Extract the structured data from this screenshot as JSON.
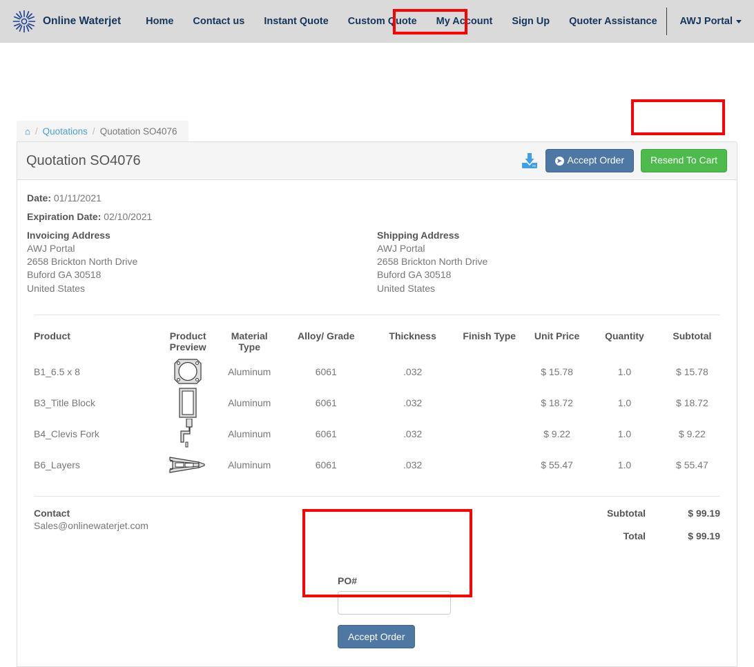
{
  "navbar": {
    "logo_icon": "sunburst-logo-icon",
    "brand": "Online Waterjet",
    "links": [
      {
        "label": "Home",
        "highlighted": false
      },
      {
        "label": "Contact us",
        "highlighted": false
      },
      {
        "label": "Instant Quote",
        "highlighted": false
      },
      {
        "label": "Custom Quote",
        "highlighted": false
      },
      {
        "label": "My Account",
        "highlighted": true
      },
      {
        "label": "Sign Up",
        "highlighted": false
      },
      {
        "label": "Quoter Assistance",
        "highlighted": false
      }
    ],
    "portal": "AWJ Portal",
    "portal_caret_icon": "chevron-down-icon"
  },
  "breadcrumb": {
    "home_icon": "home-icon",
    "separator": "/",
    "link": "Quotations",
    "current": "Quotation SO4076"
  },
  "panel": {
    "title": "Quotation SO4076",
    "download_icon": "download-icon",
    "accept_order_label": "Accept Order",
    "accept_order_icon": "arrow-right-circle-icon",
    "resend_label": "Resend To Cart",
    "accent_blue": "#4e77a3",
    "accent_green": "#4cbb4c",
    "highlight_red": "#fe0000"
  },
  "meta": {
    "date_label": "Date:",
    "date_value": "01/11/2021",
    "expiration_label": "Expiration Date:",
    "expiration_value": "02/10/2021"
  },
  "invoicing_address": {
    "title": "Invoicing Address",
    "lines": [
      "AWJ Portal",
      "2658 Brickton North Drive",
      "Buford GA 30518",
      "United States"
    ]
  },
  "shipping_address": {
    "title": "Shipping Address",
    "lines": [
      "AWJ Portal",
      "2658 Brickton North Drive",
      "Buford GA 30518",
      "United States"
    ]
  },
  "table": {
    "headers": {
      "product": "Product",
      "preview": "Product Preview",
      "material": "Material Type",
      "alloy": "Alloy/ Grade",
      "thickness": "Thickness",
      "finish": "Finish Type",
      "unit_price": "Unit Price",
      "quantity": "Quantity",
      "subtotal": "Subtotal"
    },
    "rows": [
      {
        "product": "B1_6.5 x 8",
        "preview_icon": "part-preview-flange-icon",
        "material": "Aluminum",
        "alloy": "6061",
        "thickness": ".032",
        "finish": "",
        "unit_price": "$ 15.78",
        "quantity": "1.0",
        "subtotal": "$ 15.78"
      },
      {
        "product": "B3_Title Block",
        "preview_icon": "part-preview-block-icon",
        "material": "Aluminum",
        "alloy": "6061",
        "thickness": ".032",
        "finish": "",
        "unit_price": "$ 18.72",
        "quantity": "1.0",
        "subtotal": "$ 18.72"
      },
      {
        "product": "B4_Clevis Fork",
        "preview_icon": "part-preview-fork-icon",
        "material": "Aluminum",
        "alloy": "6061",
        "thickness": ".032",
        "finish": "",
        "unit_price": "$ 9.22",
        "quantity": "1.0",
        "subtotal": "$ 9.22"
      },
      {
        "product": "B6_Layers",
        "preview_icon": "part-preview-layers-icon",
        "material": "Aluminum",
        "alloy": "6061",
        "thickness": ".032",
        "finish": "",
        "unit_price": "$ 55.47",
        "quantity": "1.0",
        "subtotal": "$ 55.47"
      }
    ]
  },
  "footer": {
    "contact_title": "Contact",
    "contact_email": "Sales@onlinewaterjet.com",
    "subtotal_label": "Subtotal",
    "subtotal_value": "$ 99.19",
    "total_label": "Total",
    "total_value": "$ 99.19"
  },
  "po_form": {
    "label": "PO#",
    "input_value": "",
    "input_placeholder": "",
    "submit_label": "Accept Order"
  }
}
